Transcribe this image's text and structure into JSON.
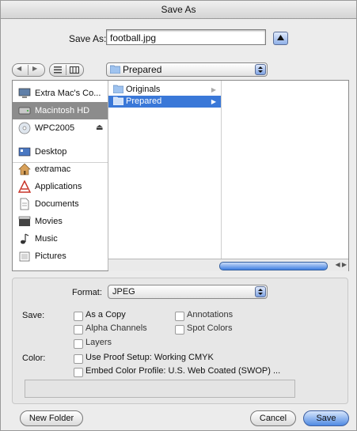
{
  "window": {
    "title": "Save As"
  },
  "save_as": {
    "label": "Save As:",
    "filename": "football.jpg"
  },
  "navigator": {
    "back_glyph": "◀",
    "forward_glyph": "▶"
  },
  "location_popup": {
    "selected": "Prepared"
  },
  "sidebar": {
    "devices": [
      {
        "label": "Extra Mac's Co...",
        "icon": "computer-icon"
      },
      {
        "label": "Macintosh HD",
        "icon": "hard-disk-icon",
        "selected": true
      },
      {
        "label": "WPC2005",
        "icon": "disc-icon",
        "eject": "⏏"
      }
    ],
    "places": [
      {
        "label": "Desktop",
        "icon": "desktop-icon"
      },
      {
        "label": "extramac",
        "icon": "home-icon"
      },
      {
        "label": "Applications",
        "icon": "applications-icon"
      },
      {
        "label": "Documents",
        "icon": "documents-icon"
      },
      {
        "label": "Movies",
        "icon": "movies-icon"
      },
      {
        "label": "Music",
        "icon": "music-icon"
      },
      {
        "label": "Pictures",
        "icon": "pictures-icon"
      }
    ]
  },
  "column1": {
    "items": [
      {
        "label": "Originals",
        "selected": false
      },
      {
        "label": "Prepared",
        "selected": true
      }
    ]
  },
  "format": {
    "label": "Format:",
    "selected": "JPEG"
  },
  "save_options": {
    "label": "Save:",
    "as_copy": "As a Copy",
    "annotations": "Annotations",
    "alpha_channels": "Alpha Channels",
    "spot_colors": "Spot Colors",
    "layers": "Layers"
  },
  "color_options": {
    "label": "Color:",
    "use_proof_setup": "Use Proof Setup:  Working CMYK",
    "embed_profile": "Embed Color Profile:  U.S. Web Coated (SWOP) ..."
  },
  "buttons": {
    "new_folder": "New Folder",
    "cancel": "Cancel",
    "save": "Save"
  },
  "colors": {
    "selection": "#3a78d8",
    "sidebar_selection": "#8c8c8c",
    "default_button": "#4f8ae3"
  }
}
